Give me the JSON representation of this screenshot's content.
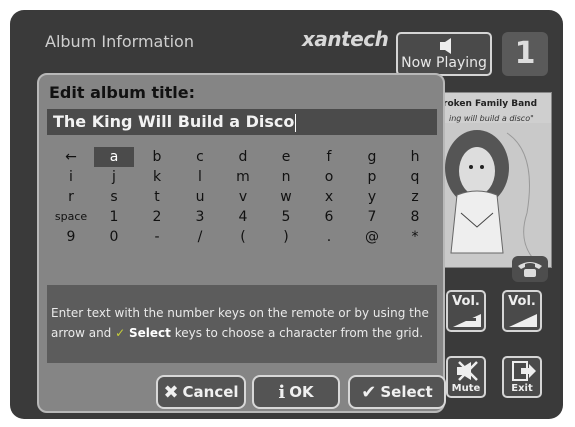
{
  "header": {
    "title": "Album Information",
    "brand": "xantech"
  },
  "now_playing": {
    "label": "Now Playing",
    "icon": "speaker-icon"
  },
  "zone": {
    "number": "1"
  },
  "album_art": {
    "band": "roken Family Band",
    "song": "ing will build a disco\""
  },
  "dialog": {
    "label": "Edit album title:",
    "value": "The King Will Build a Disco",
    "keys": [
      [
        "←",
        "a",
        "b",
        "c",
        "d",
        "e",
        "f",
        "g",
        "h"
      ],
      [
        "i",
        "j",
        "k",
        "l",
        "m",
        "n",
        "o",
        "p",
        "q"
      ],
      [
        "r",
        "s",
        "t",
        "u",
        "v",
        "w",
        "x",
        "y",
        "z"
      ],
      [
        "space",
        "1",
        "2",
        "3",
        "4",
        "5",
        "6",
        "7",
        "8"
      ],
      [
        "9",
        "0",
        "-",
        "/",
        "(",
        ")",
        ".",
        "@",
        "*"
      ]
    ],
    "selected_key": "a",
    "help": {
      "part1": "Enter text with the number keys on the remote or by using the arrow and",
      "check": "✓",
      "bold": "Select",
      "part2": "keys to choose a character from the grid."
    },
    "buttons": {
      "cancel": "Cancel",
      "ok": "OK",
      "select": "Select"
    }
  },
  "remote": {
    "vol_down": "Vol.",
    "vol_up": "Vol.",
    "mute": "Mute",
    "exit": "Exit"
  },
  "colors": {
    "background": "#3a3a3a",
    "dialog": "#858585",
    "accent_check": "#c7cf3a"
  }
}
